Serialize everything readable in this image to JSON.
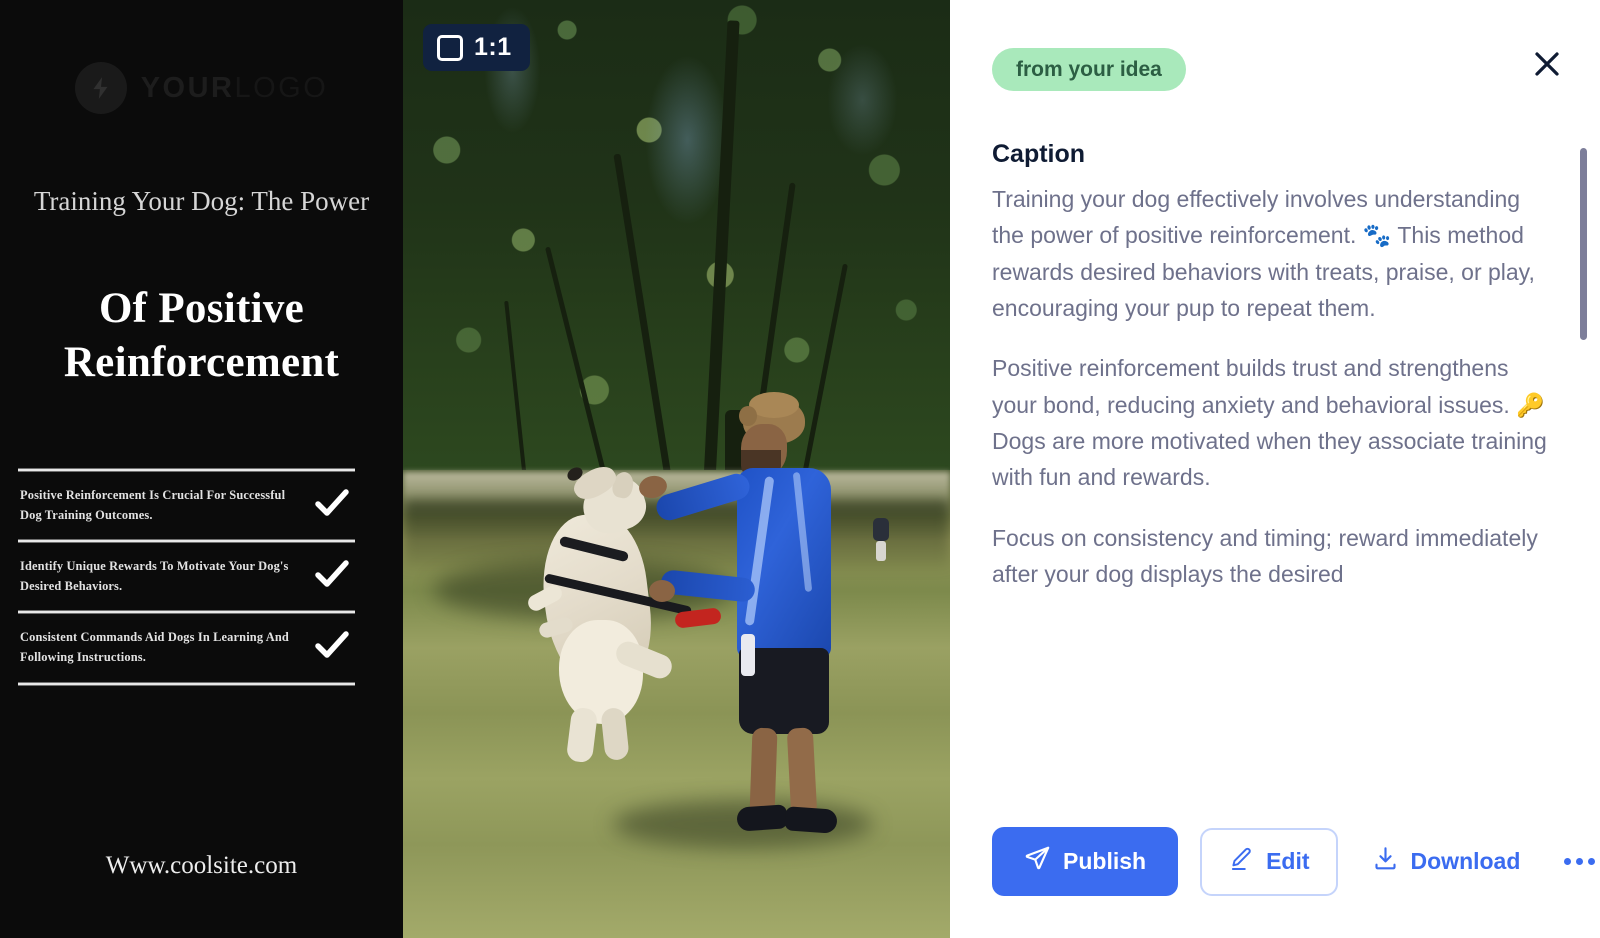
{
  "poster": {
    "logo": {
      "icon": "lightning-bolt-icon",
      "primary": "YOUR",
      "secondary": "LOGO"
    },
    "title_light": "Training Your Dog: The Power",
    "title_bold": "Of Positive Reinforcement",
    "checklist": [
      "Positive Reinforcement Is Crucial For Successful Dog Training Outcomes.",
      "Identify Unique Rewards To Motivate Your Dog's Desired Behaviors.",
      "Consistent Commands Aid Dogs In Learning And Following Instructions."
    ],
    "url": "Www.coolsite.com"
  },
  "preview": {
    "ratio_badge": {
      "icon": "square-icon",
      "label": "1:1"
    },
    "photo_alt": "Man in blue hoodie training a jumping white dog on grass in a park"
  },
  "panel": {
    "source_pill": "from your idea",
    "close_icon": "close-icon",
    "caption_heading": "Caption",
    "caption_paragraphs": [
      "Training your dog effectively involves understanding the power of positive reinforcement. 🐾 This method rewards desired behaviors with treats, praise, or play, encouraging your pup to repeat them.",
      "Positive reinforcement builds trust and strengthens your bond, reducing anxiety and behavioral issues. 🔑 Dogs are more motivated when they associate training with fun and rewards.",
      "Focus on consistency and timing; reward immediately after your dog displays the desired"
    ],
    "actions": {
      "publish": "Publish",
      "edit": "Edit",
      "download": "Download",
      "more": "More options"
    }
  },
  "colors": {
    "accent_blue": "#3b6cf0",
    "pill_green_bg": "#a9e9bb",
    "pill_green_text": "#2c5e43",
    "badge_navy": "#112240",
    "caption_text": "#6e718b",
    "heading_navy": "#0f1b33",
    "poster_bg": "#0b0b0b",
    "scrollbar": "#7d7e9a"
  }
}
